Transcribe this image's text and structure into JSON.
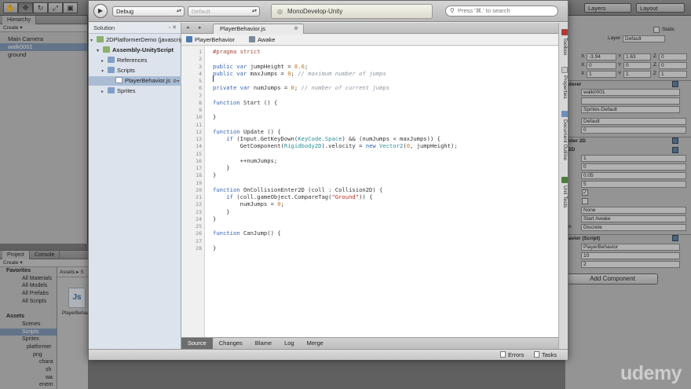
{
  "unity": {
    "layers": "Layers",
    "layout": "Layout",
    "hierarchy": {
      "tab": "Hierarchy",
      "create": "Create ▾",
      "items": [
        "Main Camera",
        "walk0001",
        "ground"
      ]
    },
    "project": {
      "tab": "Project",
      "tab2": "Console",
      "create": "Create ▾",
      "items": [
        "Favorites",
        "All Materials",
        "All Models",
        "All Prefabs",
        "All Scripts",
        "",
        "Assets",
        "Scenes",
        "Scripts",
        "Sprites",
        "platformer",
        "png",
        "chara",
        "sh",
        "wa",
        "enem"
      ],
      "assets_path": "Assets ▸ S",
      "asset_name": "PlayerBehavior",
      "asset_icon_text": "Js"
    },
    "inspector": {
      "static": "Static",
      "layer_label": "Layer",
      "layer_value": "Default",
      "pos_x": "-3.94",
      "pos_y": "1.63",
      "pos_z": "0",
      "rot_x": "0",
      "rot_y": "0",
      "rot_z": "0",
      "scl_x": "1",
      "scl_y": "1",
      "scl_z": "1",
      "renderer_title": "derer",
      "sprite_value": "walk0001",
      "material_value": "Sprites-Default",
      "sorting_value": "Default",
      "order_value": "0",
      "rb_title": "ider 2D",
      "rb_title2": "2D",
      "mass": "1",
      "drag": "0",
      "ang_drag": "0.05",
      "gravity": "5",
      "interp": "None",
      "sleep": "Start Awake",
      "collision": "Discrete",
      "interp_lbl": "",
      "collision_lbl": "n",
      "script_title": "avior (Script)",
      "script_value": "PlayerBehavior",
      "jump": "10",
      "maxjumps": "2",
      "add_component": "Add Component"
    }
  },
  "monodevelop": {
    "config": "Debug",
    "platform": "Default",
    "status": "MonoDevelop-Unity",
    "search_placeholder": "Press '⌘.' to search",
    "solution": {
      "title": "Solution",
      "controls": "▫ ✕",
      "items": [
        {
          "label": "2DPlatformerDemo (javascript)"
        },
        {
          "label": "Assembly-UnityScript"
        },
        {
          "label": "References"
        },
        {
          "label": "Scripts"
        },
        {
          "label": "PlayerBehavior.js"
        },
        {
          "label": "Sprites"
        }
      ]
    },
    "doc_tab": "PlayerBehavior.js",
    "path": {
      "class": "PlayerBehavior",
      "method": "Awake"
    },
    "line_numbers": [
      "1",
      "2",
      "3",
      "4",
      "5",
      "6",
      "7",
      "8",
      "9",
      "10",
      "11",
      "12",
      "13",
      "14",
      "15",
      "16",
      "17",
      "18",
      "19",
      "20",
      "21",
      "22",
      "23",
      "24",
      "25",
      "26",
      "27",
      "28"
    ],
    "code": {
      "l1": "#pragma strict",
      "l3a": "public var",
      "l3b": " jumpHeight = ",
      "l3c": "8.0",
      "l3d": ";",
      "l4a": "public var",
      "l4b": " maxJumps = ",
      "l4c": "0",
      "l4d": "; ",
      "l4e": "// maximum number of jumps",
      "l6a": "private var",
      "l6b": " numJumps = ",
      "l6c": "0",
      "l6d": "; ",
      "l6e": "// number of current jumps",
      "l8a": "function",
      "l8b": " Start () {",
      "l10": "}",
      "l12a": "function",
      "l12b": " Update () {",
      "l13a": "    if",
      "l13b": " (Input.GetKeyDown(",
      "l13c": "KeyCode.Space",
      "l13d": ") && (numJumps < maxJumps)) {",
      "l14a": "        GetComponent(",
      "l14b": "Rigidbody2D",
      "l14c": ").velocity = ",
      "l14d": "new",
      "l14e": " Vector2",
      "l14f": "(",
      "l14g": "0",
      "l14h": ", jumpHeight);",
      "l16": "        ++numJumps;",
      "l17": "    }",
      "l18": "}",
      "l20a": "function",
      "l20b": " OnCollisionEnter2D (coll : Collision2D) {",
      "l21a": "    if",
      "l21b": " (coll.gameObject.CompareTag(",
      "l21c": "\"Ground\"",
      "l21d": ")) {",
      "l22a": "        numJumps = ",
      "l22b": "0",
      "l22c": ";",
      "l23": "    }",
      "l24": "}",
      "l26a": "function",
      "l26b": " CanJump() {",
      "l28": "}"
    },
    "bottom_tabs": [
      "Source",
      "Changes",
      "Blame",
      "Log",
      "Merge"
    ],
    "right_dock": [
      "Toolbox",
      "Properties",
      "Document Outline",
      "Unit Tests"
    ],
    "errors": "Errors",
    "tasks": "Tasks"
  },
  "watermark": "udemy"
}
